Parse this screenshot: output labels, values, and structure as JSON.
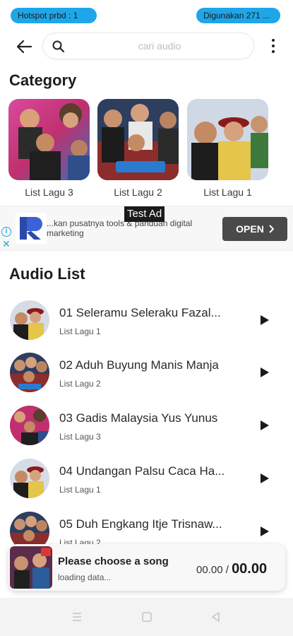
{
  "status": {
    "hotspot_label": "Hotspot prbd : 1",
    "usage_label": "Digunakan 271 ..."
  },
  "search": {
    "placeholder": "cari audio",
    "value": ""
  },
  "category": {
    "heading": "Category",
    "items": [
      {
        "label": "List Lagu 3"
      },
      {
        "label": "List Lagu 2"
      },
      {
        "label": "List Lagu 1"
      }
    ]
  },
  "ad": {
    "tag": "Test Ad",
    "text": "...kan pusatnya tools & panduan digital marketing",
    "button_label": "OPEN"
  },
  "audio_list": {
    "heading": "Audio List",
    "items": [
      {
        "title": "01 Seleramu Seleraku Fazal...",
        "list": "List Lagu 1"
      },
      {
        "title": "02 Aduh Buyung Manis Manja",
        "list": "List Lagu 2"
      },
      {
        "title": "03 Gadis Malaysia Yus Yunus",
        "list": "List Lagu 3"
      },
      {
        "title": "04 Undangan Palsu Caca Ha...",
        "list": "List Lagu 1"
      },
      {
        "title": "05 Duh Engkang Itje Trisnaw...",
        "list": "List Lagu 2"
      }
    ]
  },
  "player": {
    "title": "Please choose a song",
    "status": "loading data...",
    "time_current": "00.00",
    "time_separator": "/",
    "time_total": "00.00"
  },
  "colors": {
    "accent": "#1fa6e8",
    "ad_button": "#4a4a4a",
    "text_dark": "#1e1e1e"
  },
  "icons": {
    "back": "arrow-left-icon",
    "search": "search-icon",
    "more": "more-vert-icon",
    "play": "play-icon",
    "nav_menu": "menu-icon",
    "nav_home": "home-square-icon",
    "nav_back": "back-triangle-icon"
  }
}
